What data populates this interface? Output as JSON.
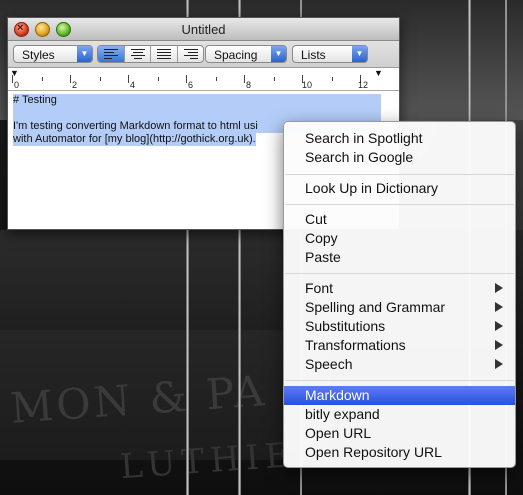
{
  "window": {
    "title": "Untitled",
    "toolbar": {
      "styles_label": "Styles",
      "spacing_label": "Spacing",
      "lists_label": "Lists"
    },
    "ruler_numbers": [
      "0",
      "2",
      "4",
      "6",
      "8",
      "10",
      "12"
    ],
    "document": {
      "line1": "# Testing",
      "line2": "I'm testing converting Markdown format to html usi",
      "line3": "with Automator for [my blog](http://gothick.org.uk)."
    }
  },
  "context_menu": {
    "items": [
      {
        "label": "Search in Spotlight"
      },
      {
        "label": "Search in Google"
      },
      {
        "label": "Look Up in Dictionary"
      },
      {
        "label": "Cut"
      },
      {
        "label": "Copy"
      },
      {
        "label": "Paste"
      },
      {
        "label": "Font"
      },
      {
        "label": "Spelling and Grammar"
      },
      {
        "label": "Substitutions"
      },
      {
        "label": "Transformations"
      },
      {
        "label": "Speech"
      },
      {
        "label": "Markdown"
      },
      {
        "label": "bitly expand"
      },
      {
        "label": "Open URL"
      },
      {
        "label": "Open Repository URL"
      }
    ]
  },
  "colors": {
    "highlight": "#2a4fe0",
    "selection": "#b4cdf8"
  }
}
